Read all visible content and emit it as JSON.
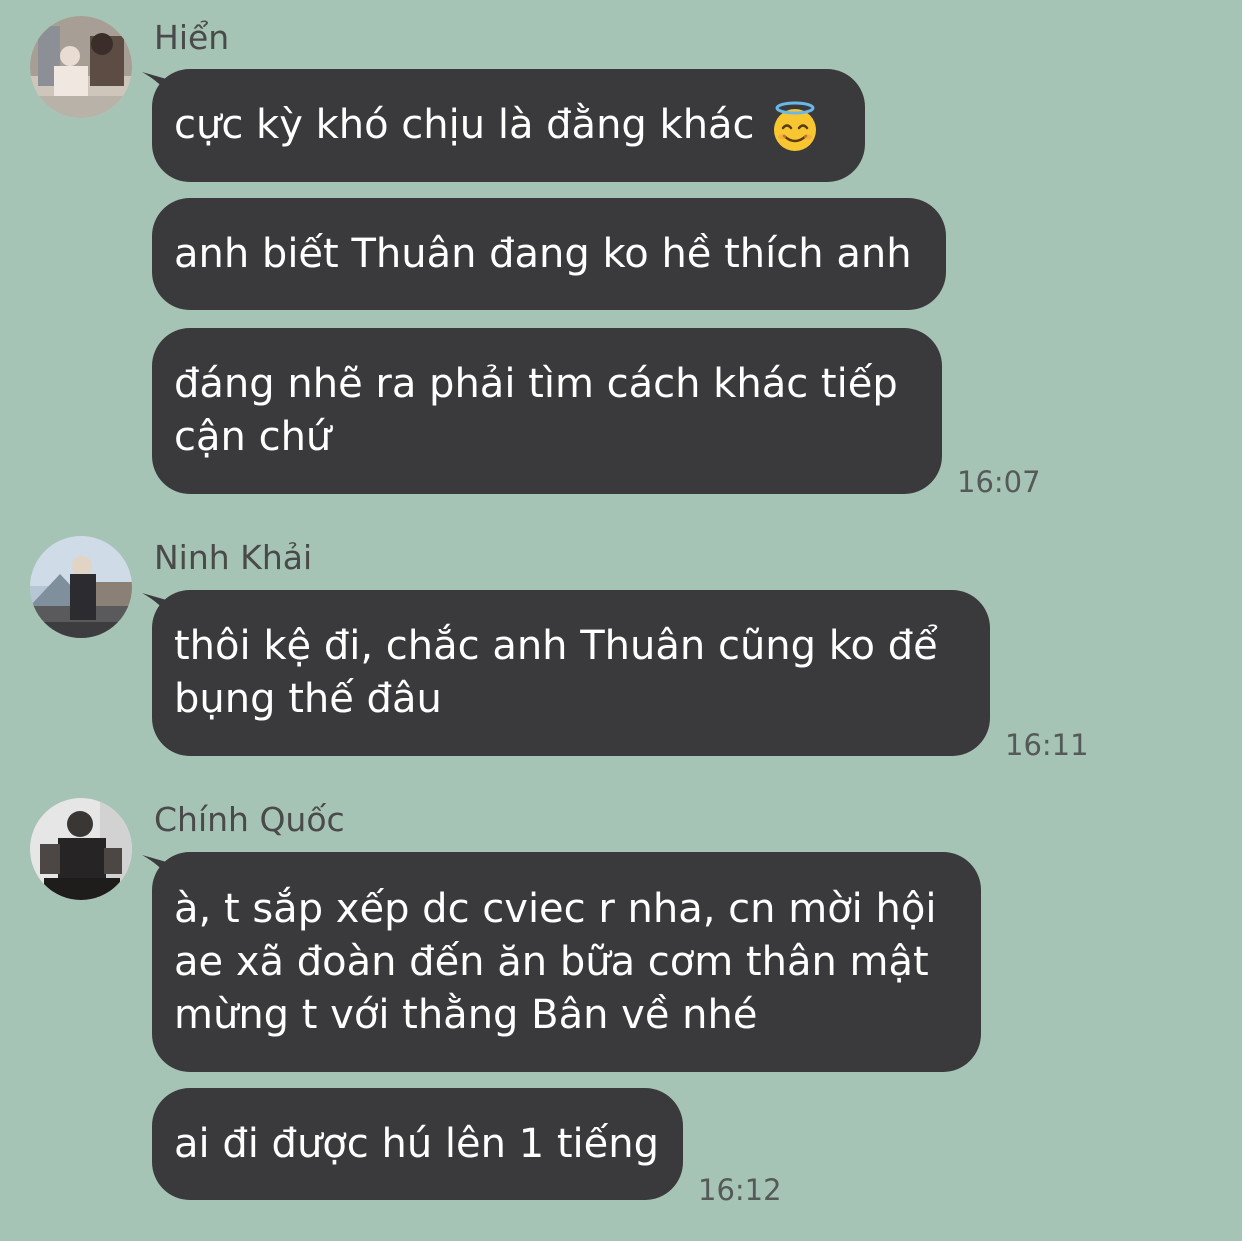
{
  "colors": {
    "background": "#a6c4b6",
    "bubble": "#3a3a3c",
    "bubble_text": "#ffffff",
    "sender_name": "#4a4a4a",
    "timestamp": "#555a58"
  },
  "groups": [
    {
      "sender": "Hiển",
      "avatar_icon": "user-avatar-photo",
      "messages": [
        {
          "text": "cực kỳ khó chịu là đằng khác",
          "emoji": "smiling-face-with-halo-icon"
        },
        {
          "text": "anh biết Thuân đang ko hề thích anh"
        },
        {
          "text": "đáng nhẽ ra phải tìm cách khác tiếp\ncận chứ"
        }
      ],
      "time": "16:07"
    },
    {
      "sender": "Ninh Khải",
      "avatar_icon": "user-avatar-photo",
      "messages": [
        {
          "text": "thôi kệ đi, chắc anh Thuân cũng ko để\nbụng thế đâu"
        }
      ],
      "time": "16:11"
    },
    {
      "sender": "Chính Quốc",
      "avatar_icon": "user-avatar-photo",
      "messages": [
        {
          "text": "à, t sắp xếp dc cviec r nha, cn mời hội\nae xã đoàn đến ăn bữa cơm thân mật\nmừng t với thằng Bân về nhé"
        },
        {
          "text": "ai đi được hú lên 1 tiếng"
        }
      ],
      "time": "16:12"
    }
  ]
}
